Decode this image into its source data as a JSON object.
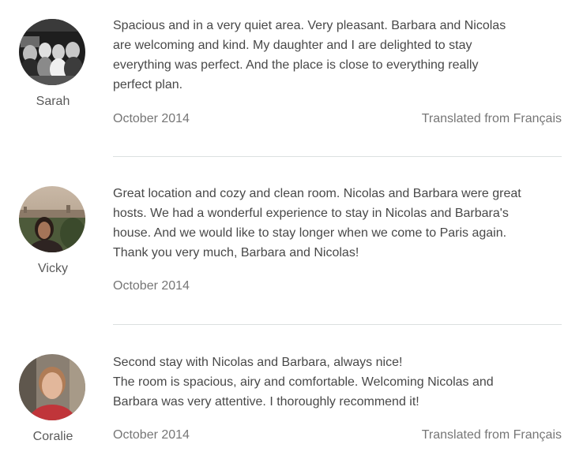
{
  "reviews": [
    {
      "reviewer": "Sarah",
      "avatar_icon": "group-photo-avatar",
      "text_lines": [
        "Spacious and in a very quiet area. Very pleasant. Barbara and Nicolas",
        "are welcoming and kind. My daughter and I are delighted to stay",
        "everything was perfect. And the place is close to everything really",
        "perfect plan."
      ],
      "date": "October 2014",
      "translated": "Translated from Français"
    },
    {
      "reviewer": "Vicky",
      "avatar_icon": "portrait-cityscape-avatar",
      "text_lines": [
        "Great location and cozy and clean room. Nicolas and Barbara were great",
        "hosts. We had a wonderful experience to stay in Nicolas and Barbara's",
        "house. And we would like to stay longer when we come to Paris again.",
        "Thank you very much, Barbara and Nicolas!"
      ],
      "date": "October 2014",
      "translated": ""
    },
    {
      "reviewer": "Coralie",
      "avatar_icon": "portrait-avatar",
      "text_lines": [
        "Second stay with Nicolas and Barbara, always nice!",
        "The room is spacious, airy and comfortable. Welcoming Nicolas and",
        "Barbara was very attentive. I thoroughly recommend it!"
      ],
      "date": "October 2014",
      "translated": "Translated from Français"
    }
  ],
  "colors": {
    "text": "#484848",
    "muted": "#767676",
    "divider": "#dce0e0"
  }
}
